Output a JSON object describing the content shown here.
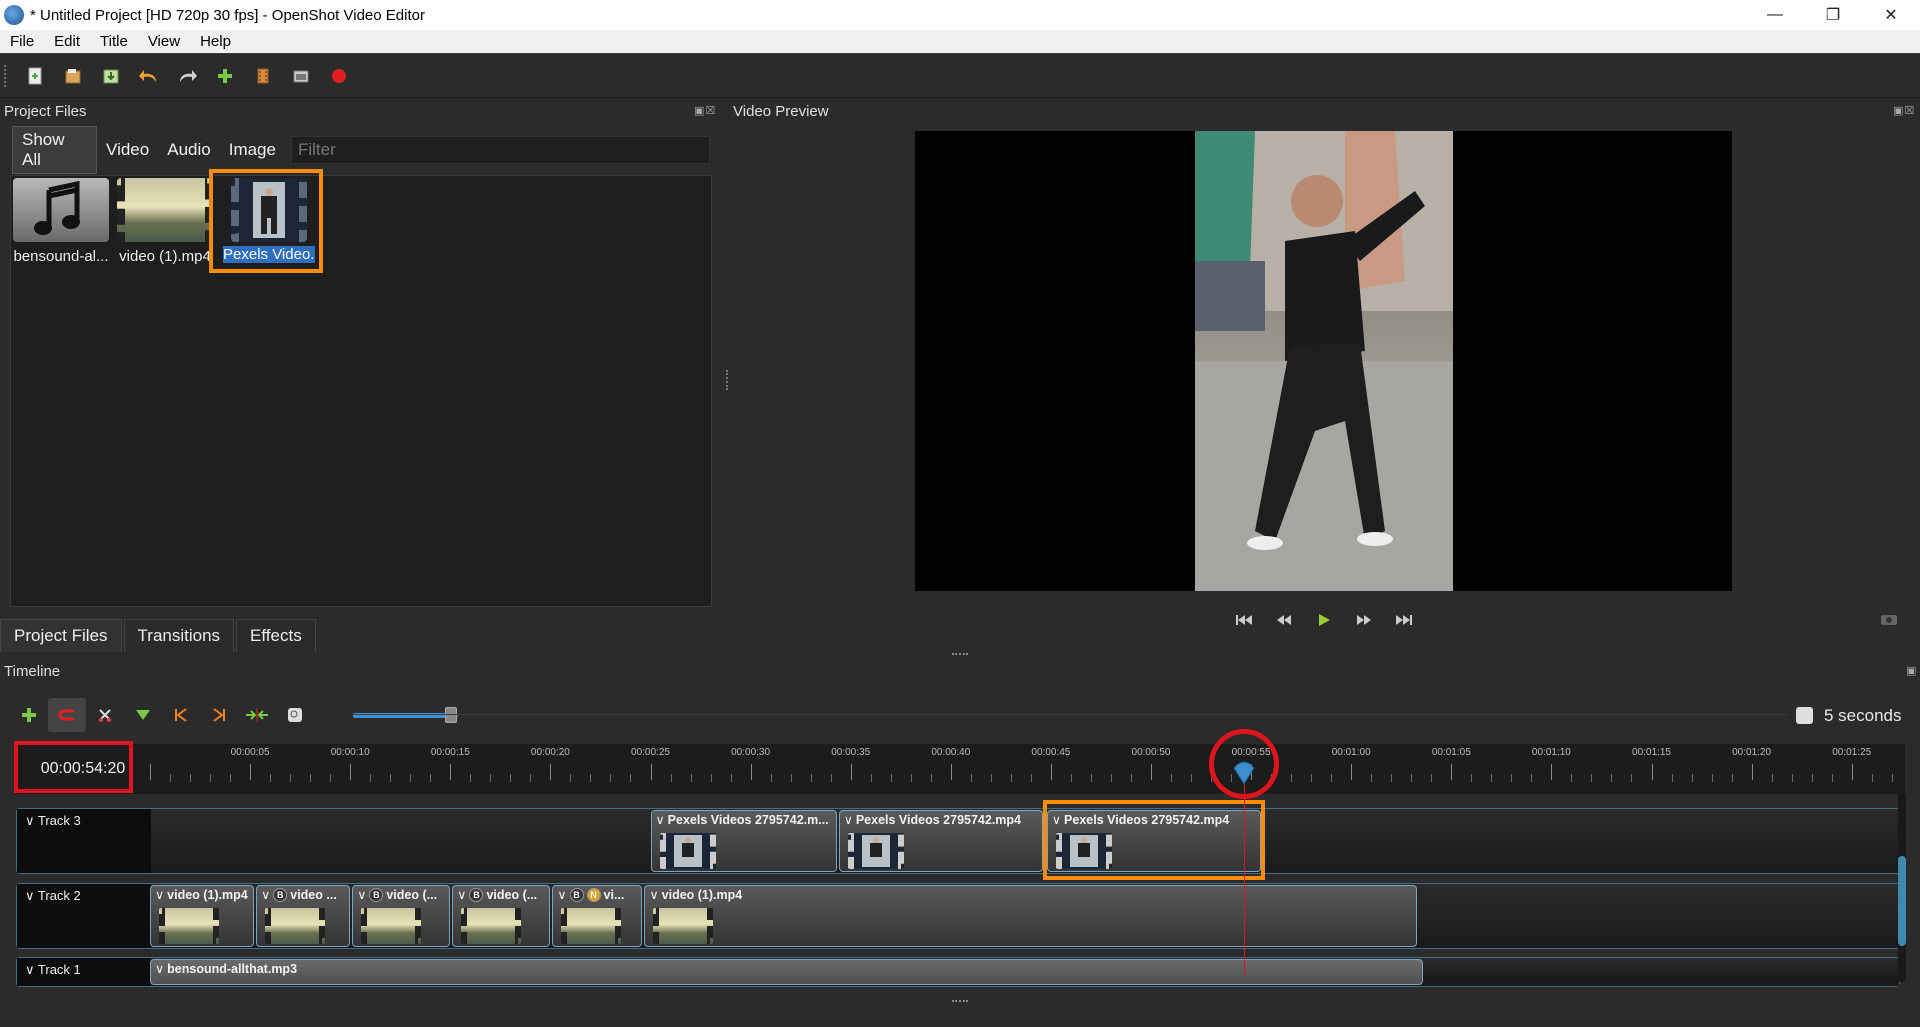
{
  "window": {
    "title": "* Untitled Project [HD 720p 30 fps] - OpenShot Video Editor"
  },
  "menu": [
    "File",
    "Edit",
    "Title",
    "View",
    "Help"
  ],
  "toolbar": {
    "icons": [
      "new-project-icon",
      "open-project-icon",
      "save-project-icon",
      "undo-icon",
      "redo-icon",
      "import-files-icon",
      "profile-icon",
      "fullscreen-icon",
      "record-icon"
    ]
  },
  "project_files": {
    "title": "Project Files",
    "filters": [
      "Show All",
      "Video",
      "Audio",
      "Image"
    ],
    "filter_placeholder": "Filter",
    "items": [
      {
        "label": "bensound-al...",
        "type": "audio"
      },
      {
        "label": "video (1).mp4",
        "type": "video"
      },
      {
        "label": "Pexels Video...",
        "type": "video",
        "selected": true
      }
    ],
    "tabs": [
      "Project Files",
      "Transitions",
      "Effects"
    ]
  },
  "preview": {
    "title": "Video Preview"
  },
  "timeline": {
    "title": "Timeline",
    "timecode": "00:00:54:20",
    "zoom_label": "5 seconds",
    "zoom_level": 0.93,
    "ruler": [
      "00:00:05",
      "00:00:10",
      "00:00:15",
      "00:00:20",
      "00:00:25",
      "00:00:30",
      "00:00:35",
      "00:00:40",
      "00:00:45",
      "00:00:50",
      "00:00:55",
      "00:01:00",
      "00:01:05",
      "00:01:10",
      "00:01:15",
      "00:01:20",
      "00:01:25"
    ],
    "playhead_seconds": 54.67,
    "seconds_per_tick_label": 5,
    "tracks": [
      {
        "name": "Track 3",
        "clips": [
          {
            "title": "Pexels Videos 2795742.m...",
            "start": 25,
            "end": 34.3
          },
          {
            "title": "Pexels Videos 2795742.mp4",
            "start": 34.4,
            "end": 44.6
          },
          {
            "title": "Pexels Videos 2795742.mp4",
            "start": 44.8,
            "end": 55.5,
            "highlighted": true
          }
        ]
      },
      {
        "name": "Track 2",
        "clips": [
          {
            "title": "video (1).mp4",
            "start": 0,
            "end": 5.2
          },
          {
            "title": "video ...",
            "badges": [
              "B"
            ],
            "start": 5.3,
            "end": 10
          },
          {
            "title": "video (...",
            "badges": [
              "B"
            ],
            "start": 10.1,
            "end": 15
          },
          {
            "title": "video (...",
            "badges": [
              "B"
            ],
            "start": 15.1,
            "end": 20
          },
          {
            "title": "vi...",
            "badges": [
              "B",
              "N"
            ],
            "start": 20.1,
            "end": 24.6
          },
          {
            "title": "video (1).mp4",
            "start": 24.7,
            "end": 63.3
          }
        ]
      },
      {
        "name": "Track 1",
        "clips": [
          {
            "title": "bensound-allthat.mp3",
            "start": 0,
            "end": 63.6
          }
        ]
      }
    ]
  },
  "colors": {
    "accent": "#3f8fd2",
    "playhead": "#e0141e",
    "highlight_red": "#e0141e",
    "highlight_orange": "#ff8c00"
  }
}
